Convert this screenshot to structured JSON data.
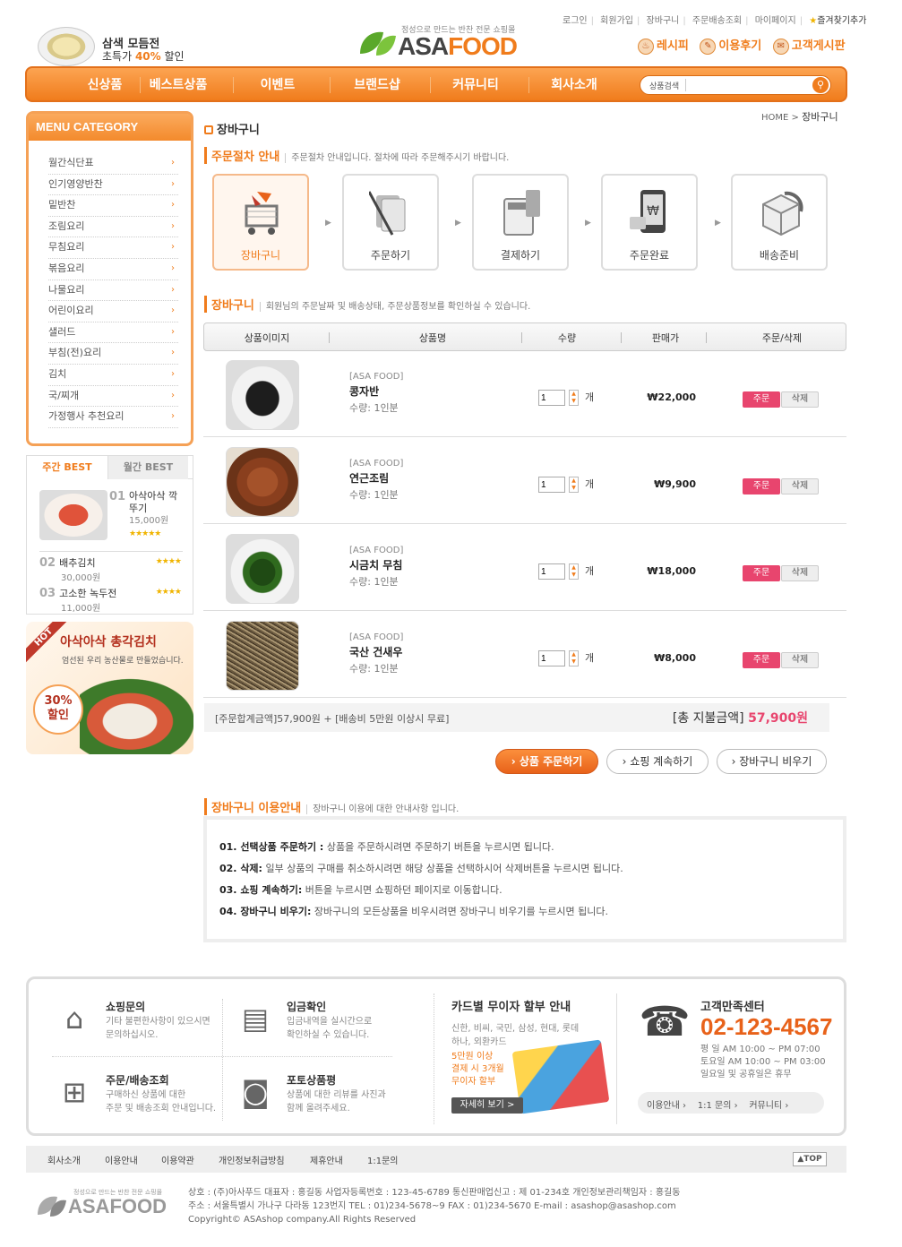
{
  "header": {
    "promo_line1": "삼색 모듬전",
    "promo_line2_prefix": "초특가",
    "promo_percent": "40%",
    "promo_line2_suffix": "할인",
    "logo_tagline": "정성으로 만드는 반찬 전문 쇼핑몰",
    "logo_text_accent": "ASA",
    "logo_text": "FOOD",
    "top_links": [
      "로그인",
      "회원가입",
      "장바구니",
      "주문배송조회",
      "마이페이지"
    ],
    "favorite": "즐겨찾기추가",
    "quick_links": [
      "레시피",
      "이용후기",
      "고객게시판"
    ]
  },
  "gnb": {
    "items": [
      "신상품",
      "베스트상품",
      "이벤트",
      "브랜드샵",
      "커뮤니티",
      "회사소개"
    ],
    "search_label": "상품검색",
    "search_placeholder": ""
  },
  "sidebar": {
    "title": "MENU CATEGORY",
    "categories": [
      "월간식단표",
      "인기영양반찬",
      "밑반찬",
      "조림요리",
      "무침요리",
      "볶음요리",
      "나물요리",
      "어린이요리",
      "샐러드",
      "부침(전)요리",
      "김치",
      "국/찌개",
      "가정행사 추천요리"
    ],
    "best_tabs": [
      "주간 BEST",
      "월간 BEST"
    ],
    "best_items": [
      {
        "rank": "01",
        "name": "아삭아삭 깍뚜기",
        "price": "15,000원",
        "stars": "★★★★★"
      },
      {
        "rank": "02",
        "name": "배추김치",
        "price": "30,000원",
        "stars": "★★★★"
      },
      {
        "rank": "03",
        "name": "고소한 녹두전",
        "price": "11,000원",
        "stars": "★★★★"
      }
    ],
    "banner": {
      "hot": "HOT",
      "title": "아삭아삭 총각김치",
      "subtitle": "엄선된 우리 농산물로 만들었습니다.",
      "percent": "30%",
      "discount": "할인"
    }
  },
  "page": {
    "title": "장바구니",
    "breadcrumb_home": "HOME",
    "breadcrumb_sep": ">",
    "breadcrumb_current": "장바구니"
  },
  "process": {
    "heading": "주문절차 안내",
    "desc": "주문절차 안내입니다. 절차에 따라 주문해주시기 바랍니다.",
    "steps": [
      "장바구니",
      "주문하기",
      "결제하기",
      "주문완료",
      "배송준비"
    ]
  },
  "cart": {
    "heading": "장바구니",
    "desc": "회원님의 주문날짜 및 배송상태, 주문상품정보를 확인하실 수 있습니다.",
    "columns": [
      "상품이미지",
      "상품명",
      "수량",
      "판매가",
      "주문/삭제"
    ],
    "items": [
      {
        "brand": "[ASA FOOD]",
        "name": "콩자반",
        "qty_label": "수량: 1인분",
        "qty": "1",
        "unit": "개",
        "price": "₩22,000",
        "img": "black-beans"
      },
      {
        "brand": "[ASA FOOD]",
        "name": "연근조림",
        "qty_label": "수량: 1인분",
        "qty": "1",
        "unit": "개",
        "price": "₩9,900",
        "img": "lotus-root"
      },
      {
        "brand": "[ASA FOOD]",
        "name": "시금치 무침",
        "qty_label": "수량: 1인분",
        "qty": "1",
        "unit": "개",
        "price": "₩18,000",
        "img": "spinach"
      },
      {
        "brand": "[ASA FOOD]",
        "name": "국산 건새우",
        "qty_label": "수량: 1인분",
        "qty": "1",
        "unit": "개",
        "price": "₩8,000",
        "img": "dried-shrimp"
      }
    ],
    "order_btn": "주문",
    "delete_btn": "삭제",
    "summary": "[주문합계금액]57,900원 + [배송비 5만원 이상시 무료]",
    "total_label": "[총 지불금액]",
    "total_value": "57,900원",
    "actions": [
      "상품 주문하기",
      "쇼핑 계속하기",
      "장바구니 비우기"
    ]
  },
  "guide": {
    "heading": "장바구니 이용안내",
    "desc": "장바구니 이용에 대한 안내사항 입니다.",
    "items": [
      {
        "title": "01. 선택상품 주문하기 :",
        "text": "상품을 주문하시려면 주문하기 버튼을 누르시면 됩니다."
      },
      {
        "title": "02. 삭제:",
        "text": "일부 상품의 구매를 취소하시려면 해당 상품을 선택하시어 삭제버튼을 누르시면 됩니다."
      },
      {
        "title": "03. 쇼핑 계속하기:",
        "text": "버튼을 누르시면 쇼핑하던 페이지로 이동합니다."
      },
      {
        "title": "04. 장바구니 비우기:",
        "text": "장바구니의 모든상품을 비우시려면 장바구니 비우기를 누르시면 됩니다."
      }
    ]
  },
  "footer": {
    "services": [
      {
        "title": "쇼핑문의",
        "line1": "기타 불편한사항이 있으시면",
        "line2": "문의하십시오."
      },
      {
        "title": "입금확인",
        "line1": "입금내역을 실시간으로",
        "line2": "확인하실 수 있습니다."
      },
      {
        "title": "주문/배송조회",
        "line1": "구매하신 상품에 대한",
        "line2": "주문 및 배송조회 안내입니다."
      },
      {
        "title": "포토상품평",
        "line1": "상품에 대한 리뷰를 사진과",
        "line2": "함께 올려주세요."
      }
    ],
    "card": {
      "title": "카드별 무이자 할부 안내",
      "cards": "신한, 비씨, 국민, 삼성, 현대, 롯데 하나, 외환카드",
      "offer1": "5만원 이상",
      "offer2": "결제 시 3개월",
      "offer3": "무이자 할부",
      "more": "자세히 보기 >"
    },
    "cs": {
      "title": "고객만족센터",
      "phone": "02-123-4567",
      "hours1": "평   일 AM 10:00 ~ PM 07:00",
      "hours2": "토요일 AM 10:00 ~ PM 03:00",
      "hours3": "일요일 및 공휴일은 휴무",
      "links": [
        "이용안내",
        "1:1 문의",
        "커뮤니티"
      ]
    },
    "nav": [
      "회사소개",
      "이용안내",
      "이용약관",
      "개인정보취급방침",
      "제휴안내",
      "1:1문의"
    ],
    "top": "▲TOP",
    "logo_tagline": "정성으로 만드는 반찬 전문 쇼핑몰",
    "logo_text": "ASAFOOD",
    "info1": "상호 : (주)아사푸드    대표자 : 홍길동    사업자등록번호 : 123-45-6789    통신판매업신고 : 제 01-234호    개인정보관리책임자 : 홍길동",
    "info2": "주소 : 서울특별시 가나구 다라동 123번지    TEL : 01)234-5678~9    FAX : 01)234-5670    E-mail : asashop@asashop.com",
    "copyright": "Copyright© ASAshop company.All Rights Reserved"
  },
  "colors": {
    "accent": "#f07c1c",
    "order": "#e8456e"
  }
}
